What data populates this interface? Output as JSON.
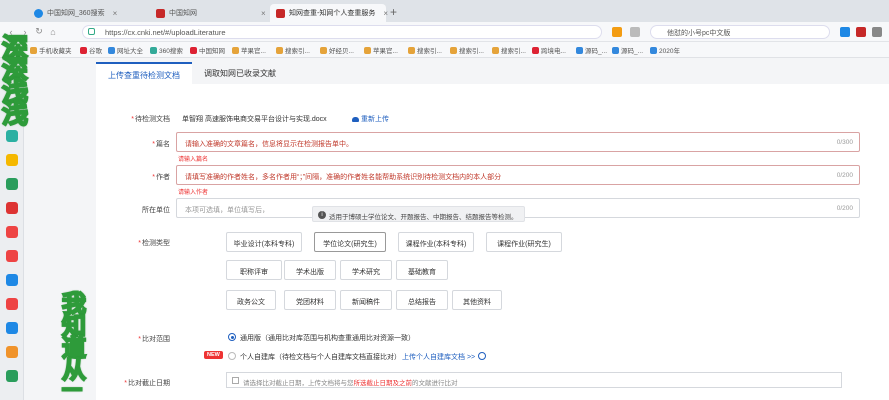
{
  "browser": {
    "tabs": [
      {
        "label": "中国知网_360搜索",
        "active": false
      },
      {
        "label": "中国知网",
        "active": false
      },
      {
        "label": "知网查重-知网个人查重服务",
        "active": true
      }
    ],
    "new_tab": "+",
    "url": "https://cx.cnki.net/#/uploadLiterature",
    "search_text": "他怼的小号pc中文版",
    "bookmarks": [
      "手机收藏夹",
      "谷歌",
      "网址大全",
      "360搜索",
      "中国知网",
      "苹果官...",
      "搜索引...",
      "好经贝...",
      "苹果官...",
      "搜索引...",
      "搜索引...",
      "搜索引...",
      "跨境电...",
      "源码_...",
      "源码_...",
      "2020年"
    ]
  },
  "page": {
    "tabs": [
      "上传查重待检测文档",
      "调取知网已收录文献"
    ],
    "file_label": "待检测文档",
    "file_name": "单智翔 高速服饰电商交易平台设计与实现.docx",
    "reupload": "重新上传",
    "title_label": "篇名",
    "title_placeholder": "请输入准确的文章篇名，信息将显示在检测报告单中。",
    "title_count": "0/300",
    "title_error": "请输入篇名",
    "author_label": "作者",
    "author_placeholder": "请填写准确的作者姓名，多名作者用“；”间隔，准确的作者姓名能帮助系统识别待检测文档内的本人部分",
    "author_count": "0/200",
    "author_error": "请输入作者",
    "unit_label": "所在单位",
    "unit_placeholder": "本项可选填，单位填写后，",
    "unit_count": "0/200",
    "tooltip": "适用于博硕士学位论文、开题报告、中期报告、结题报告等检测。",
    "type_label": "检测类型",
    "types_row1": [
      "毕业设计(本科专科)",
      "学位论文(研究生)",
      "课程作业(本科专科)",
      "课程作业(研究生)"
    ],
    "types_row2": [
      "职称评审",
      "学术出版",
      "学术研究",
      "基础教育"
    ],
    "types_row3": [
      "政务公文",
      "党团材料",
      "新闻稿件",
      "总结报告",
      "其他资料"
    ],
    "scope_label": "比对范围",
    "scope_general": "通用版（通用比对库范围与机构查重通用比对资源一致）",
    "scope_personal": "个人自建库（待检文档与个人自建库文档直接比对）",
    "scope_upload": "上传个人自建库文档 >>",
    "new_badge": "NEW",
    "date_label": "比对截止日期",
    "date_pre": "请选择比对截止日期，上传文档将与您",
    "date_red": "所选截止日期及之前",
    "date_post": "的文献进行比对"
  },
  "watermark": {
    "left": [
      "深",
      "深",
      "浅",
      "浅"
    ],
    "right": [
      "我",
      "知",
      "道",
      "从",
      "一"
    ]
  }
}
